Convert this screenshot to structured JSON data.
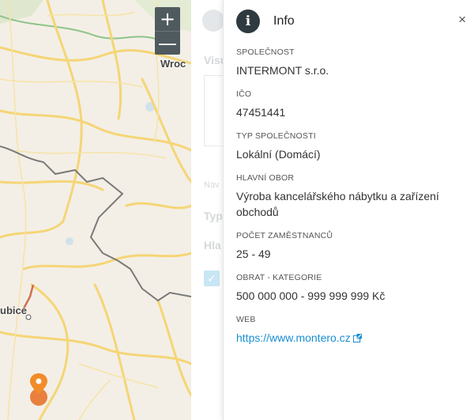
{
  "map": {
    "labels": {
      "city_top": "Wroc",
      "city_left": "ubice"
    },
    "zoom_in": "+",
    "zoom_out": "—"
  },
  "background_panel": {
    "heading_visu": "Visu",
    "label_nav": "Nav",
    "label_typ": "Typ",
    "label_hla": "Hla"
  },
  "info_panel": {
    "title": "Info",
    "close": "×",
    "icon": "info-circle-icon",
    "fields": [
      {
        "label": "SPOLEČNOST",
        "value": "INTERMONT s.r.o."
      },
      {
        "label": "IČO",
        "value": "47451441"
      },
      {
        "label": "TYP SPOLEČNOSTI",
        "value": "Lokální (Domácí)"
      },
      {
        "label": "HLAVNÍ OBOR",
        "value": "Výroba kancelářského nábytku a zařízení obchodů"
      },
      {
        "label": "POČET ZAMĚSTNANCŮ",
        "value": "25 - 49"
      },
      {
        "label": "OBRAT - KATEGORIE",
        "value": "500 000 000 - 999 999 999 Kč"
      }
    ],
    "web": {
      "label": "WEB",
      "url": "https://www.montero.cz"
    }
  },
  "colors": {
    "accent_link": "#1a8fd1",
    "marker": "#e8722c",
    "info_icon_bg": "#2e3a40",
    "road": "#f7d77a",
    "border": "#7a7a7a"
  }
}
